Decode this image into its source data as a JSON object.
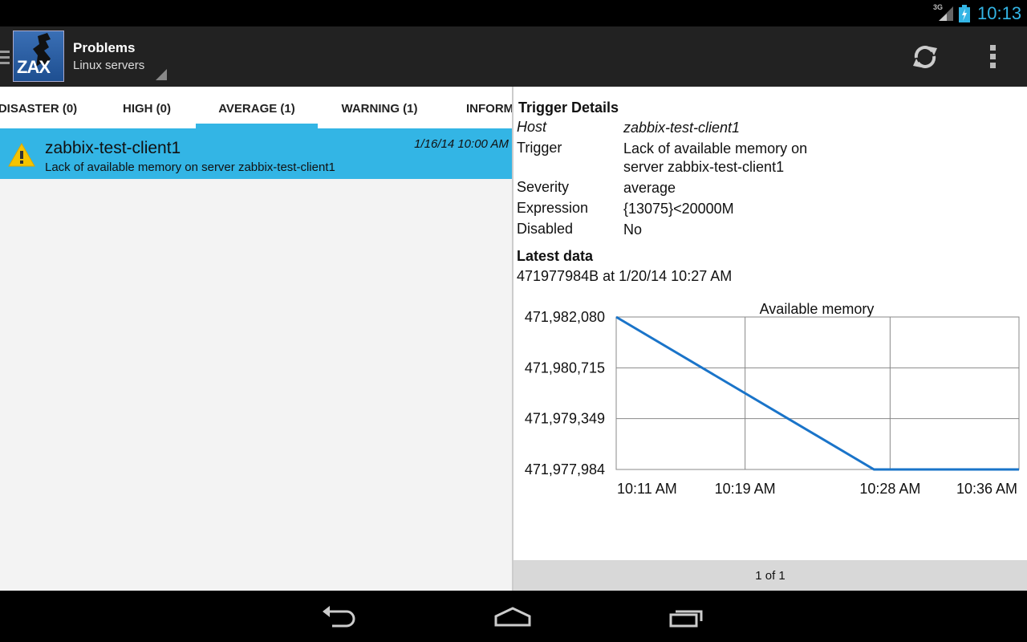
{
  "status_bar": {
    "network": "3G",
    "time": "10:13"
  },
  "action_bar": {
    "logo_text": "ZAX",
    "title": "Problems",
    "subtitle": "Linux servers",
    "icons": [
      "menu-icon",
      "refresh-icon",
      "overflow-menu-icon"
    ]
  },
  "tabs": [
    {
      "label": "DISASTER (0)",
      "selected": false
    },
    {
      "label": "HIGH (0)",
      "selected": false
    },
    {
      "label": "AVERAGE (1)",
      "selected": true
    },
    {
      "label": "WARNING (1)",
      "selected": false
    },
    {
      "label": "INFORM",
      "selected": false
    }
  ],
  "problems": [
    {
      "host": "zabbix-test-client1",
      "description": "Lack of available memory on server zabbix-test-client1",
      "date": "1/16/14 10:00 AM",
      "severity_icon": "warning-icon"
    }
  ],
  "details": {
    "title": "Trigger Details",
    "rows": [
      {
        "label": "Host",
        "value": "zabbix-test-client1"
      },
      {
        "label": "Trigger",
        "value": "Lack of available memory on server zabbix-test-client1"
      },
      {
        "label": "Severity",
        "value": "average"
      },
      {
        "label": "Expression",
        "value": "{13075}<20000M"
      },
      {
        "label": "Disabled",
        "value": "No"
      }
    ]
  },
  "latest_data": {
    "title": "Latest data",
    "value": "471977984B at 1/20/14 10:27 AM"
  },
  "chart_data": {
    "type": "line",
    "title": "Available memory",
    "x": [
      "10:11 AM",
      "10:19 AM",
      "10:28 AM",
      "10:36 AM"
    ],
    "y_ticks": [
      "471,982,080",
      "471,980,715",
      "471,979,349",
      "471,977,984"
    ],
    "ylim": [
      471977984,
      471982080
    ],
    "grid": true,
    "series": [
      {
        "values": [
          {
            "t": "10:11 AM",
            "y": 471982080
          },
          {
            "t": "10:27 AM",
            "y": 471977984
          },
          {
            "t": "10:36 AM",
            "y": 471977984
          }
        ],
        "color": "#1a74c9"
      }
    ]
  },
  "pager": {
    "text": "1 of 1"
  },
  "colors": {
    "accent": "#33b5e5",
    "action_bar": "#222222",
    "series": "#1a74c9"
  },
  "nav_bar": {
    "icons": [
      "back-icon",
      "home-icon",
      "recents-icon"
    ]
  }
}
